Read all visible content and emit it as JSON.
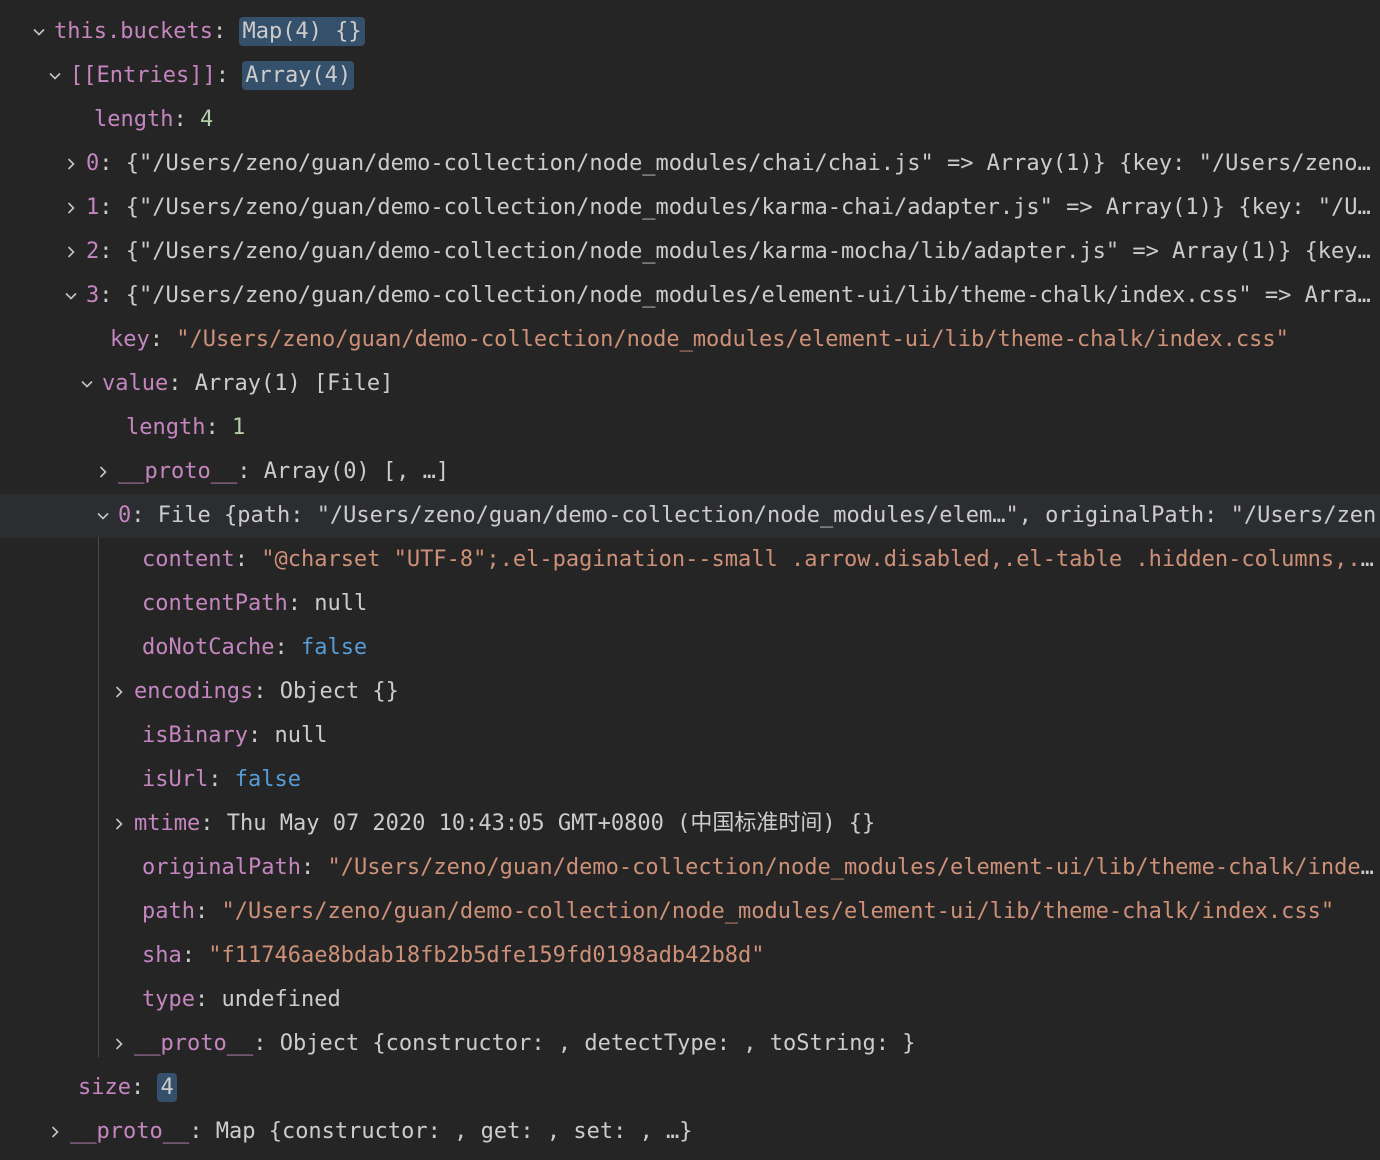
{
  "rows": [
    {
      "key": "this.buckets",
      "value": "Map(4) {}",
      "twist": "down",
      "indent": 30,
      "highlight": true
    },
    {
      "key": "[[Entries]]",
      "value": "Array(4)",
      "twist": "down",
      "indent": 46,
      "highlight": true
    },
    {
      "key": "length",
      "value": "4",
      "twist": "none",
      "indent": 94,
      "vtype": "n"
    },
    {
      "key": "0",
      "value": "{\"/Users/zeno/guan/demo-collection/node_modules/chai/chai.js\" => Array(1)} {key: \"/Users/zeno/…",
      "twist": "right",
      "indent": 62
    },
    {
      "key": "1",
      "value": "{\"/Users/zeno/guan/demo-collection/node_modules/karma-chai/adapter.js\" => Array(1)} {key: \"/Us…",
      "twist": "right",
      "indent": 62
    },
    {
      "key": "2",
      "value": "{\"/Users/zeno/guan/demo-collection/node_modules/karma-mocha/lib/adapter.js\" => Array(1)} {key:…",
      "twist": "right",
      "indent": 62
    },
    {
      "key": "3",
      "value": "{\"/Users/zeno/guan/demo-collection/node_modules/element-ui/lib/theme-chalk/index.css\" => Array…",
      "twist": "down",
      "indent": 62
    },
    {
      "key": "key",
      "value": "\"/Users/zeno/guan/demo-collection/node_modules/element-ui/lib/theme-chalk/index.css\"",
      "twist": "none",
      "indent": 110,
      "vtype": "s"
    },
    {
      "key": "value",
      "value": "Array(1) [File]",
      "twist": "down",
      "indent": 78
    },
    {
      "key": "length",
      "value": "1",
      "twist": "none",
      "indent": 126,
      "vtype": "n"
    },
    {
      "key": "__proto__",
      "value": "Array(0) [, …]",
      "twist": "right",
      "indent": 94
    },
    {
      "key": "0",
      "value": "File {path: \"/Users/zeno/guan/demo-collection/node_modules/elem…\", originalPath: \"/Users/zen",
      "twist": "down",
      "indent": 94,
      "focused": true
    },
    {
      "key": "content",
      "value": "\"@charset \"UTF-8\";.el-pagination--small .arrow.disabled,.el-table .hidden-columns,.e…",
      "twist": "none",
      "indent": 142,
      "vtype": "s"
    },
    {
      "key": "contentPath",
      "value": "null",
      "twist": "none",
      "indent": 142
    },
    {
      "key": "doNotCache",
      "value": "false",
      "twist": "none",
      "indent": 142,
      "vtype": "b"
    },
    {
      "key": "encodings",
      "value": "Object {}",
      "twist": "right",
      "indent": 110
    },
    {
      "key": "isBinary",
      "value": "null",
      "twist": "none",
      "indent": 142
    },
    {
      "key": "isUrl",
      "value": "false",
      "twist": "none",
      "indent": 142,
      "vtype": "b"
    },
    {
      "key": "mtime",
      "value": "Thu May 07 2020 10:43:05 GMT+0800 (中国标准时间) {}",
      "twist": "right",
      "indent": 110
    },
    {
      "key": "originalPath",
      "value": "\"/Users/zeno/guan/demo-collection/node_modules/element-ui/lib/theme-chalk/index…",
      "twist": "none",
      "indent": 142,
      "vtype": "s"
    },
    {
      "key": "path",
      "value": "\"/Users/zeno/guan/demo-collection/node_modules/element-ui/lib/theme-chalk/index.css\"",
      "twist": "none",
      "indent": 142,
      "vtype": "s"
    },
    {
      "key": "sha",
      "value": "\"f11746ae8bdab18fb2b5dfe159fd0198adb42b8d\"",
      "twist": "none",
      "indent": 142,
      "vtype": "s"
    },
    {
      "key": "type",
      "value": "undefined",
      "twist": "none",
      "indent": 142
    },
    {
      "key": "__proto__",
      "value": "Object {constructor: , detectType: , toString: }",
      "twist": "right",
      "indent": 110
    },
    {
      "key": "size",
      "value": "4",
      "twist": "none",
      "indent": 78,
      "highlight": true,
      "vtype": "n"
    },
    {
      "key": "__proto__",
      "value": "Map {constructor: , get: , set: , …}",
      "twist": "right",
      "indent": 46
    }
  ],
  "colors": {
    "background": "#252526",
    "key": "#c586c0",
    "string": "#ce9178",
    "number": "#b5cea8",
    "boolean": "#569cd6",
    "value": "#cccccc",
    "highlight": "#35506b"
  }
}
